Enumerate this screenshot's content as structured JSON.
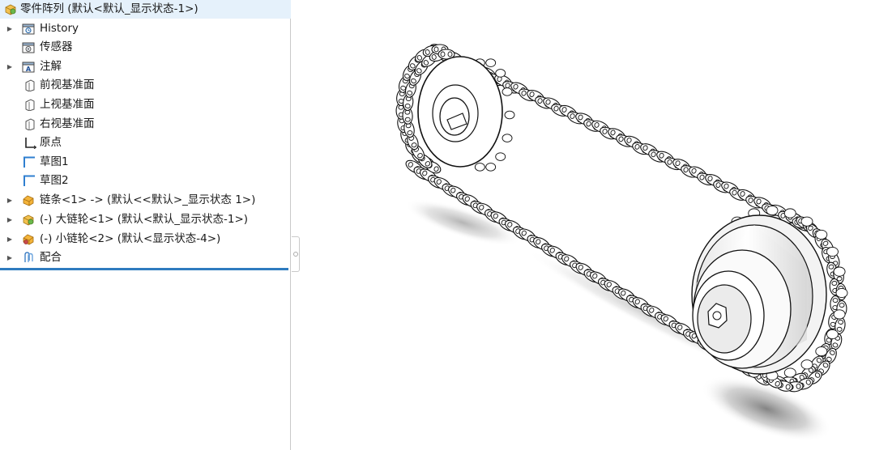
{
  "tree": {
    "root_label": "零件阵列  (默认<默认_显示状态-1>)",
    "items": [
      {
        "label": "History",
        "expandable": true
      },
      {
        "label": "传感器",
        "expandable": false
      },
      {
        "label": "注解",
        "expandable": true
      },
      {
        "label": "前视基准面",
        "expandable": false
      },
      {
        "label": "上视基准面",
        "expandable": false
      },
      {
        "label": "右视基准面",
        "expandable": false
      },
      {
        "label": "原点",
        "expandable": false
      },
      {
        "label": "草图1",
        "expandable": false
      },
      {
        "label": "草图2",
        "expandable": false
      },
      {
        "label": "链条<1> -> (默认<<默认>_显示状态 1>)",
        "expandable": true
      },
      {
        "label": "(-) 大链轮<1> (默认<默认_显示状态-1>)",
        "expandable": true
      },
      {
        "label": "(-) 小链轮<2> (默认<显示状态-4>)",
        "expandable": true
      },
      {
        "label": "配合",
        "expandable": true
      }
    ]
  },
  "icons": {
    "root": "assembly-icon",
    "history": "history-folder-icon",
    "sensors": "sensor-folder-icon",
    "annotations": "annotation-folder-icon",
    "plane": "plane-icon",
    "origin": "origin-icon",
    "sketch": "sketch-icon",
    "part": "part-icon",
    "mates": "mates-icon"
  },
  "colors": {
    "selection_line": "#2e7bbf",
    "part_icon": "#f0b030",
    "sketch_icon": "#2f7fd0"
  }
}
